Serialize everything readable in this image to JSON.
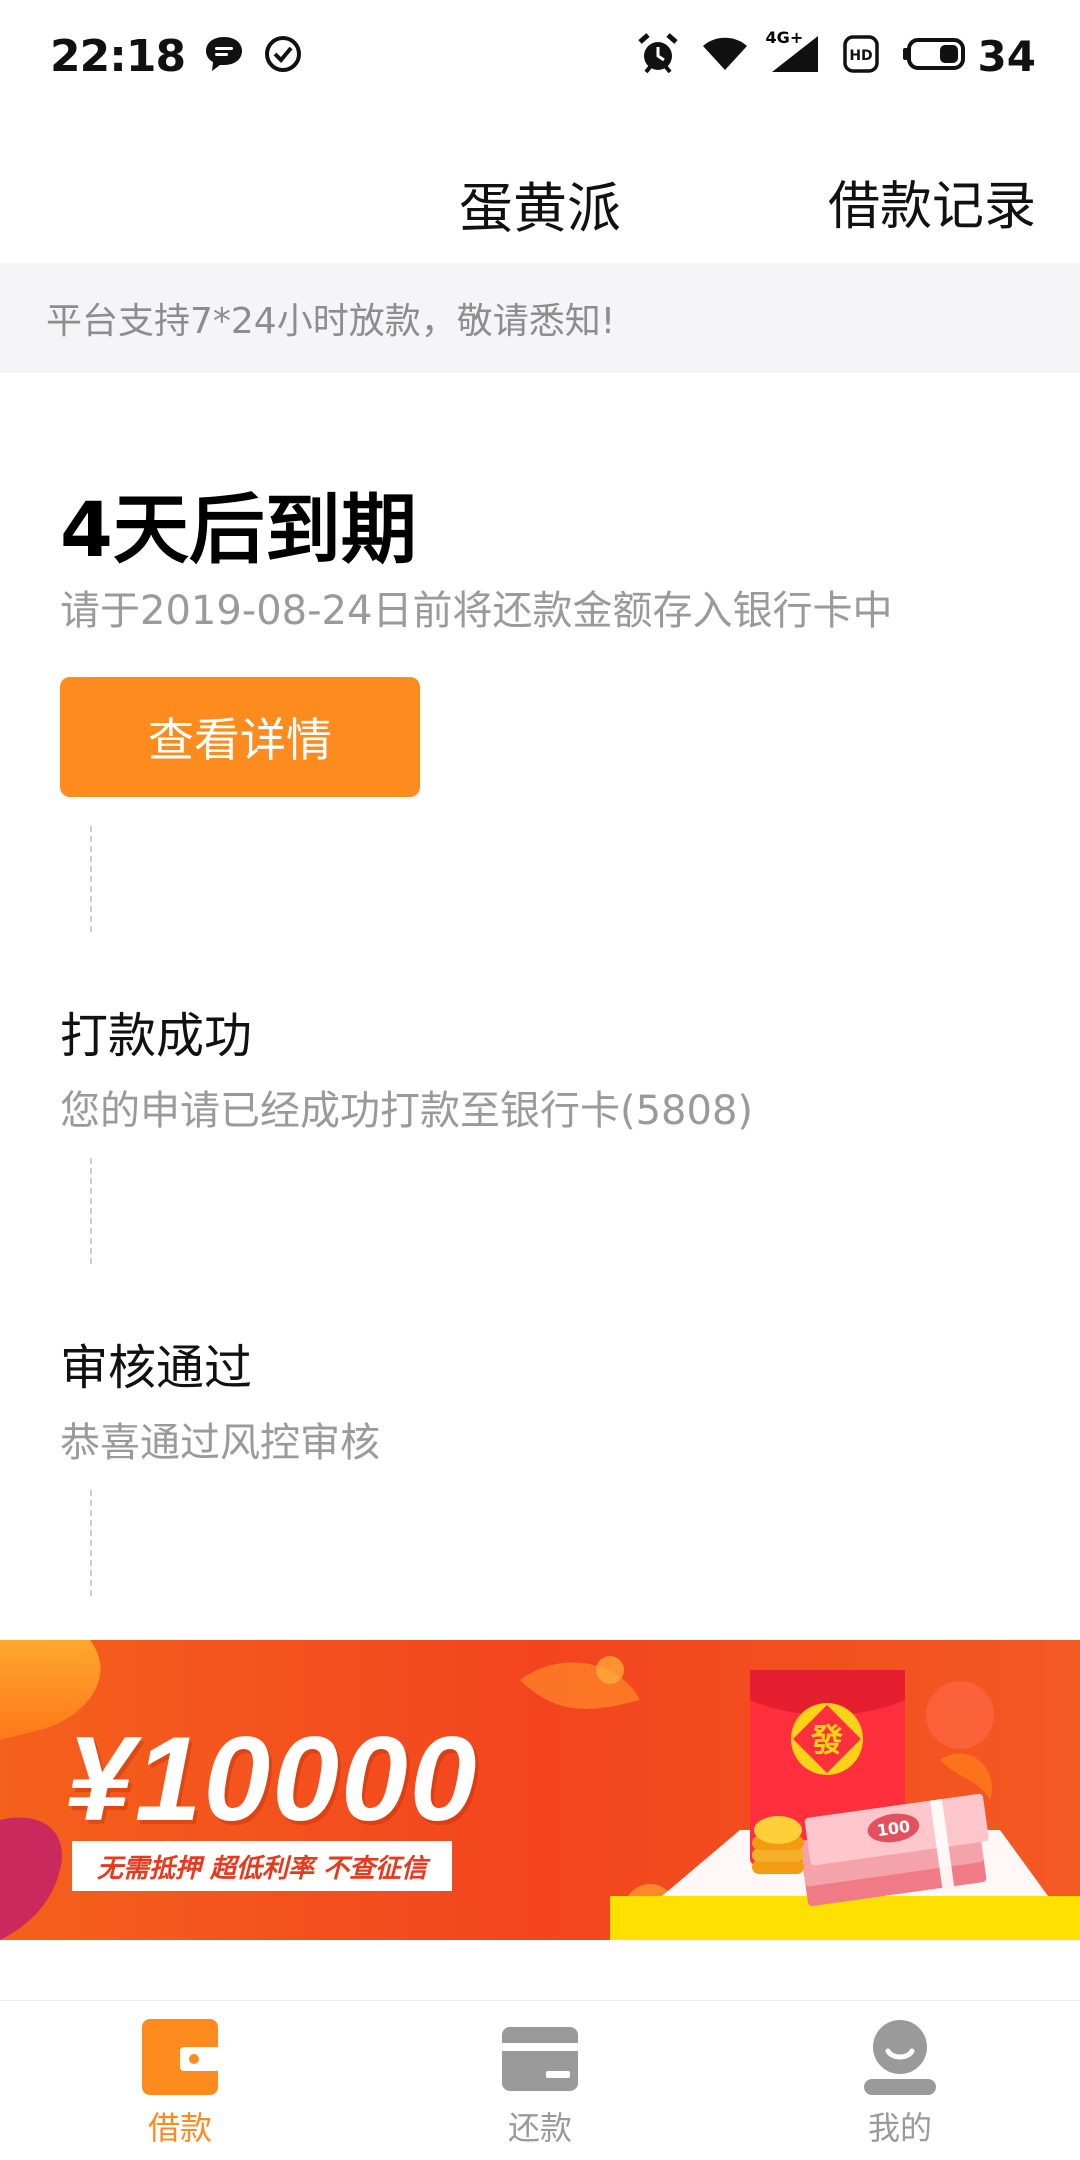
{
  "status_bar": {
    "time": "22:18",
    "battery": "34",
    "network": "4G+",
    "left_icons": [
      "message-icon",
      "check-circle-icon"
    ],
    "right_icons": [
      "alarm-icon",
      "wifi-icon",
      "signal-icon",
      "hd-icon",
      "battery-icon"
    ]
  },
  "header": {
    "title": "蛋黄派",
    "action": "借款记录"
  },
  "notice": {
    "text": "平台支持7*24小时放款，敬请悉知!"
  },
  "timeline": {
    "due_title": "4天后到期",
    "due_desc": "请于2019-08-24日前将还款金额存入银行卡中",
    "detail_button": "查看详情",
    "steps": [
      {
        "title": "打款成功",
        "desc": "您的申请已经成功打款至银行卡(5808)"
      },
      {
        "title": "审核通过",
        "desc": "恭喜通过风控审核"
      }
    ]
  },
  "banner": {
    "amount": "¥10000",
    "tagline": "无需抵押 超低利率 不查征信",
    "badge": "發",
    "note": "100"
  },
  "bottom_nav": {
    "items": [
      {
        "label": "借款",
        "icon": "wallet-icon",
        "active": true
      },
      {
        "label": "还款",
        "icon": "card-icon",
        "active": false
      },
      {
        "label": "我的",
        "icon": "user-icon",
        "active": false
      }
    ]
  },
  "colors": {
    "accent": "#fe8b1e",
    "text_primary": "#111111",
    "text_secondary": "#9a9a9a",
    "notice_bg": "#f5f5f7",
    "nav_inactive": "#9a9a9a",
    "banner_red": "#f4511e"
  }
}
